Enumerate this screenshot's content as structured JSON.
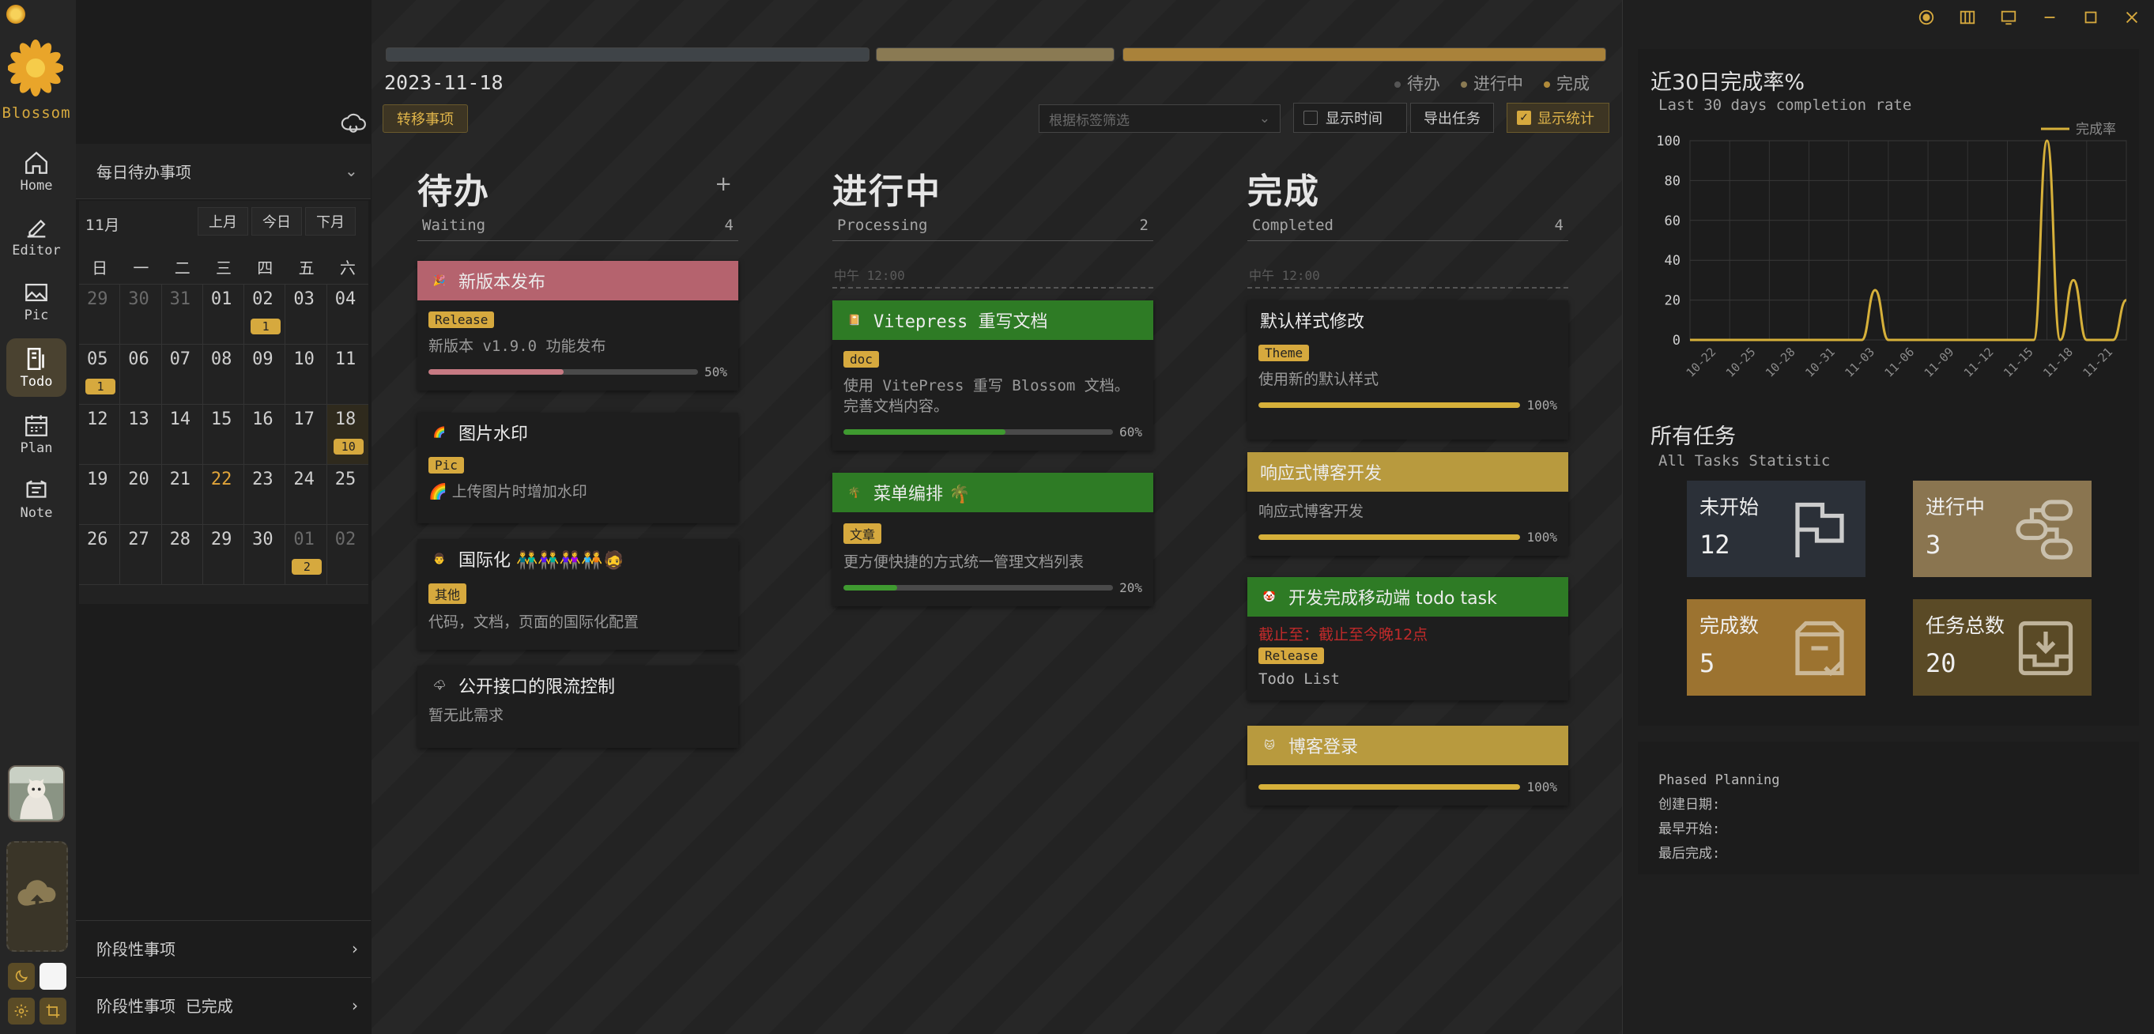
{
  "app": {
    "brand": "Blossom"
  },
  "nav": [
    {
      "id": "home",
      "label": "Home"
    },
    {
      "id": "editor",
      "label": "Editor"
    },
    {
      "id": "pic",
      "label": "Pic"
    },
    {
      "id": "todo",
      "label": "Todo",
      "active": true
    },
    {
      "id": "plan",
      "label": "Plan"
    },
    {
      "id": "note",
      "label": "Note"
    }
  ],
  "sidebar": {
    "daily_title": "每日待办事项",
    "month_label": "11月",
    "prev_month": "上月",
    "today": "今日",
    "next_month": "下月",
    "weekdays": [
      "日",
      "一",
      "二",
      "三",
      "四",
      "五",
      "六"
    ],
    "weeks": [
      [
        {
          "d": "29",
          "o": true
        },
        {
          "d": "30",
          "o": true
        },
        {
          "d": "31",
          "o": true
        },
        {
          "d": "01"
        },
        {
          "d": "02",
          "c": "1"
        },
        {
          "d": "03"
        },
        {
          "d": "04"
        }
      ],
      [
        {
          "d": "05",
          "c": "1"
        },
        {
          "d": "06"
        },
        {
          "d": "07"
        },
        {
          "d": "08"
        },
        {
          "d": "09"
        },
        {
          "d": "10"
        },
        {
          "d": "11"
        }
      ],
      [
        {
          "d": "12"
        },
        {
          "d": "13"
        },
        {
          "d": "14"
        },
        {
          "d": "15"
        },
        {
          "d": "16"
        },
        {
          "d": "17"
        },
        {
          "d": "18",
          "c": "10",
          "sel": true
        }
      ],
      [
        {
          "d": "19"
        },
        {
          "d": "20"
        },
        {
          "d": "21"
        },
        {
          "d": "22",
          "today": true
        },
        {
          "d": "23"
        },
        {
          "d": "24"
        },
        {
          "d": "25"
        }
      ],
      [
        {
          "d": "26"
        },
        {
          "d": "27"
        },
        {
          "d": "28"
        },
        {
          "d": "29"
        },
        {
          "d": "30"
        },
        {
          "d": "01",
          "o": true,
          "c": "2"
        },
        {
          "d": "02",
          "o": true
        }
      ]
    ],
    "phase_label": "阶段性事项",
    "phase_done_label": "阶段性事项  已完成"
  },
  "toolbar": {
    "date": "2023-11-18",
    "transfer": "转移事项",
    "legend": {
      "waiting": "待办",
      "processing": "进行中",
      "completed": "完成"
    },
    "filter_placeholder": "根据标签筛选",
    "show_time": "显示时间",
    "export": "导出任务",
    "show_stats": "显示统计"
  },
  "columns": {
    "waiting": {
      "title": "待办",
      "subtitle": "Waiting",
      "count": "4",
      "add": "+"
    },
    "processing": {
      "title": "进行中",
      "subtitle": "Processing",
      "count": "2",
      "time": "中午 12:00"
    },
    "completed": {
      "title": "完成",
      "subtitle": "Completed",
      "count": "4",
      "time": "中午 12:00"
    }
  },
  "cards": {
    "w1": {
      "icon": "🎉",
      "title": "新版本发布",
      "tag": "Release",
      "desc": "新版本 v1.9.0 功能发布",
      "pct": "50%",
      "progress": 0.5
    },
    "w2": {
      "icon": "🌈",
      "title": "图片水印",
      "tag": "Pic",
      "desc": "上传图片时增加水印"
    },
    "w3": {
      "icon": "👨",
      "title": "国际化 👬👫👭🧑‍🤝‍🧑🧔",
      "tag": "其他",
      "desc": "代码，文档，页面的国际化配置"
    },
    "w4": {
      "icon": "🌩",
      "title": "公开接口的限流控制",
      "desc": "暂无此需求"
    },
    "p1": {
      "icon": "📔",
      "title": "Vitepress 重写文档",
      "tag": "doc",
      "desc": "使用 VitePress 重写 Blossom 文档。完善文档内容。",
      "pct": "60%",
      "progress": 0.6
    },
    "p2": {
      "icon": "🌴",
      "title": "菜单编排 🌴",
      "tag": "文章",
      "desc": "更方便快捷的方式统一管理文档列表",
      "pct": "20%",
      "progress": 0.2
    },
    "c1": {
      "title": "默认样式修改",
      "tag": "Theme",
      "desc": "使用新的默认样式",
      "pct": "100%",
      "progress": 1
    },
    "c2": {
      "title": "响应式博客开发",
      "desc": "响应式博客开发",
      "pct": "100%",
      "progress": 1
    },
    "c3": {
      "icon": "🤡",
      "title": "开发完成移动端 todo task",
      "deadline": "截止至：截止至今晚12点",
      "tag": "Release",
      "desc": "Todo List"
    },
    "c4": {
      "icon": "🐱",
      "title": "博客登录",
      "pct": "100%",
      "progress": 1
    }
  },
  "stats_panel": {
    "chart_title": "近30日完成率%",
    "chart_subtitle": "Last 30 days completion rate",
    "all_tasks_title": "所有任务",
    "all_tasks_subtitle": "All Tasks Statistic",
    "not_started": {
      "label": "未开始",
      "value": "12"
    },
    "in_progress": {
      "label": "进行中",
      "value": "3"
    },
    "completed": {
      "label": "完成数",
      "value": "5"
    },
    "total": {
      "label": "任务总数",
      "value": "20"
    },
    "colors": {
      "not_started": "#2b3038",
      "in_progress": "#8a7550",
      "completed": "#9c7330",
      "total": "#5a4a26"
    }
  },
  "phased_planning": {
    "title": "Phased Planning",
    "created": "创建日期:",
    "earliest": "最早开始:",
    "latest": "最后完成:"
  },
  "chart_data": {
    "type": "line",
    "title": "近30日完成率%",
    "subtitle": "Last 30 days completion rate",
    "legend": "完成率",
    "legend_position": "top-right",
    "x": [
      "10-20",
      "10-21",
      "10-22",
      "10-23",
      "10-24",
      "10-25",
      "10-26",
      "10-27",
      "10-28",
      "10-29",
      "10-30",
      "10-31",
      "11-01",
      "11-02",
      "11-03",
      "11-04",
      "11-05",
      "11-06",
      "11-07",
      "11-08",
      "11-09",
      "11-10",
      "11-11",
      "11-12",
      "11-13",
      "11-14",
      "11-15",
      "11-16",
      "11-17",
      "11-18",
      "11-19",
      "11-20",
      "11-21",
      "11-22"
    ],
    "x_tick_labels": [
      "10-22",
      "10-25",
      "10-28",
      "10-31",
      "11-03",
      "11-06",
      "11-09",
      "11-12",
      "11-15",
      "11-18",
      "11-21"
    ],
    "series": [
      {
        "name": "完成率",
        "values": [
          0,
          0,
          0,
          0,
          0,
          0,
          0,
          0,
          0,
          0,
          0,
          0,
          0,
          0,
          25,
          0,
          0,
          0,
          0,
          0,
          0,
          0,
          0,
          0,
          0,
          0,
          0,
          100,
          0,
          30,
          0,
          0,
          0,
          20
        ]
      }
    ],
    "ylim": [
      0,
      100
    ],
    "yticks": [
      0,
      20,
      40,
      60,
      80,
      100
    ],
    "grid": true,
    "color": "#d6b03a"
  }
}
